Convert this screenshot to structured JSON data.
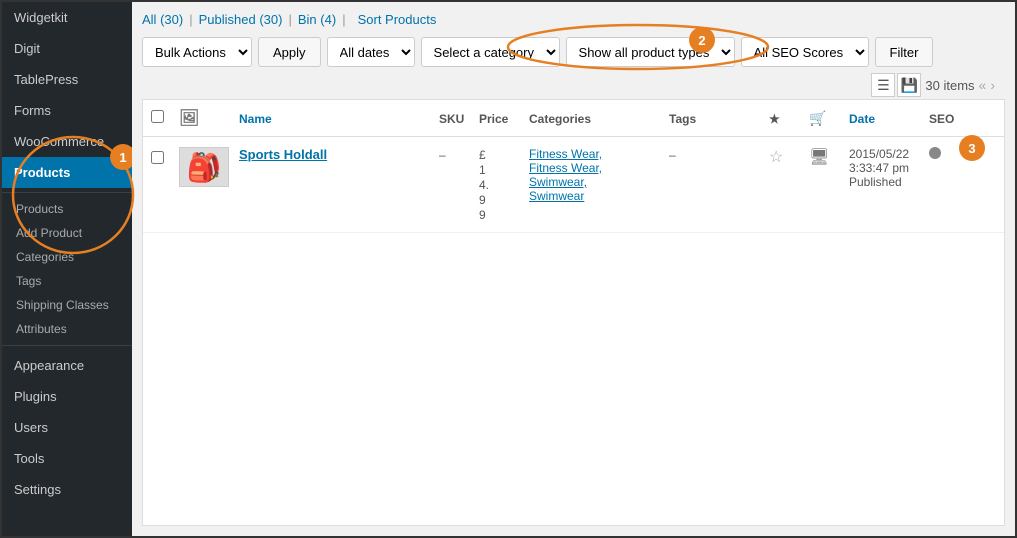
{
  "sidebar": {
    "items": [
      {
        "label": "Widgetkit",
        "active": false
      },
      {
        "label": "Digit",
        "active": false
      },
      {
        "label": "TablePress",
        "active": false
      },
      {
        "label": "Forms",
        "active": false
      },
      {
        "label": "WooCommerce",
        "active": false
      },
      {
        "label": "Products",
        "active": true
      },
      {
        "label": "Products",
        "sub": true
      },
      {
        "label": "Add Product",
        "sub": true
      },
      {
        "label": "Categories",
        "sub": true
      },
      {
        "label": "Tags",
        "sub": true
      },
      {
        "label": "Shipping Classes",
        "sub": true
      },
      {
        "label": "Attributes",
        "sub": true
      },
      {
        "label": "Appearance",
        "active": false
      },
      {
        "label": "Plugins",
        "active": false
      },
      {
        "label": "Users",
        "active": false
      },
      {
        "label": "Tools",
        "active": false
      },
      {
        "label": "Settings",
        "active": false
      }
    ]
  },
  "annotations": {
    "one": "1",
    "two": "2",
    "three": "3"
  },
  "tabs": {
    "all_label": "All",
    "all_count": "30",
    "published_label": "Published",
    "published_count": "30",
    "bin_label": "Bin",
    "bin_count": "4",
    "sort_label": "Sort Products"
  },
  "filters": {
    "bulk_actions": "Bulk Actions",
    "apply": "Apply",
    "all_dates": "All dates",
    "select_category": "Select a category",
    "show_all_product_types": "Show all product types",
    "all_seo_scores": "All SEO Scores",
    "filter_btn": "Filter"
  },
  "items_count": "30 items",
  "table": {
    "columns": [
      "",
      "",
      "Name",
      "SKU",
      "Price",
      "Categories",
      "Tags",
      "★",
      "🛒",
      "Date",
      "SEO"
    ],
    "rows": [
      {
        "name": "Sports Holdall",
        "sku": "–",
        "price": "£ 1 4. 9 9",
        "categories": [
          "Fitness Wear,",
          "Fitness Wear,",
          "Swimwear,",
          "Swimwear"
        ],
        "tags": "–",
        "date": "2015/05/22",
        "time": "3:33:47 pm",
        "status": "Published",
        "seo": "grey"
      }
    ]
  }
}
